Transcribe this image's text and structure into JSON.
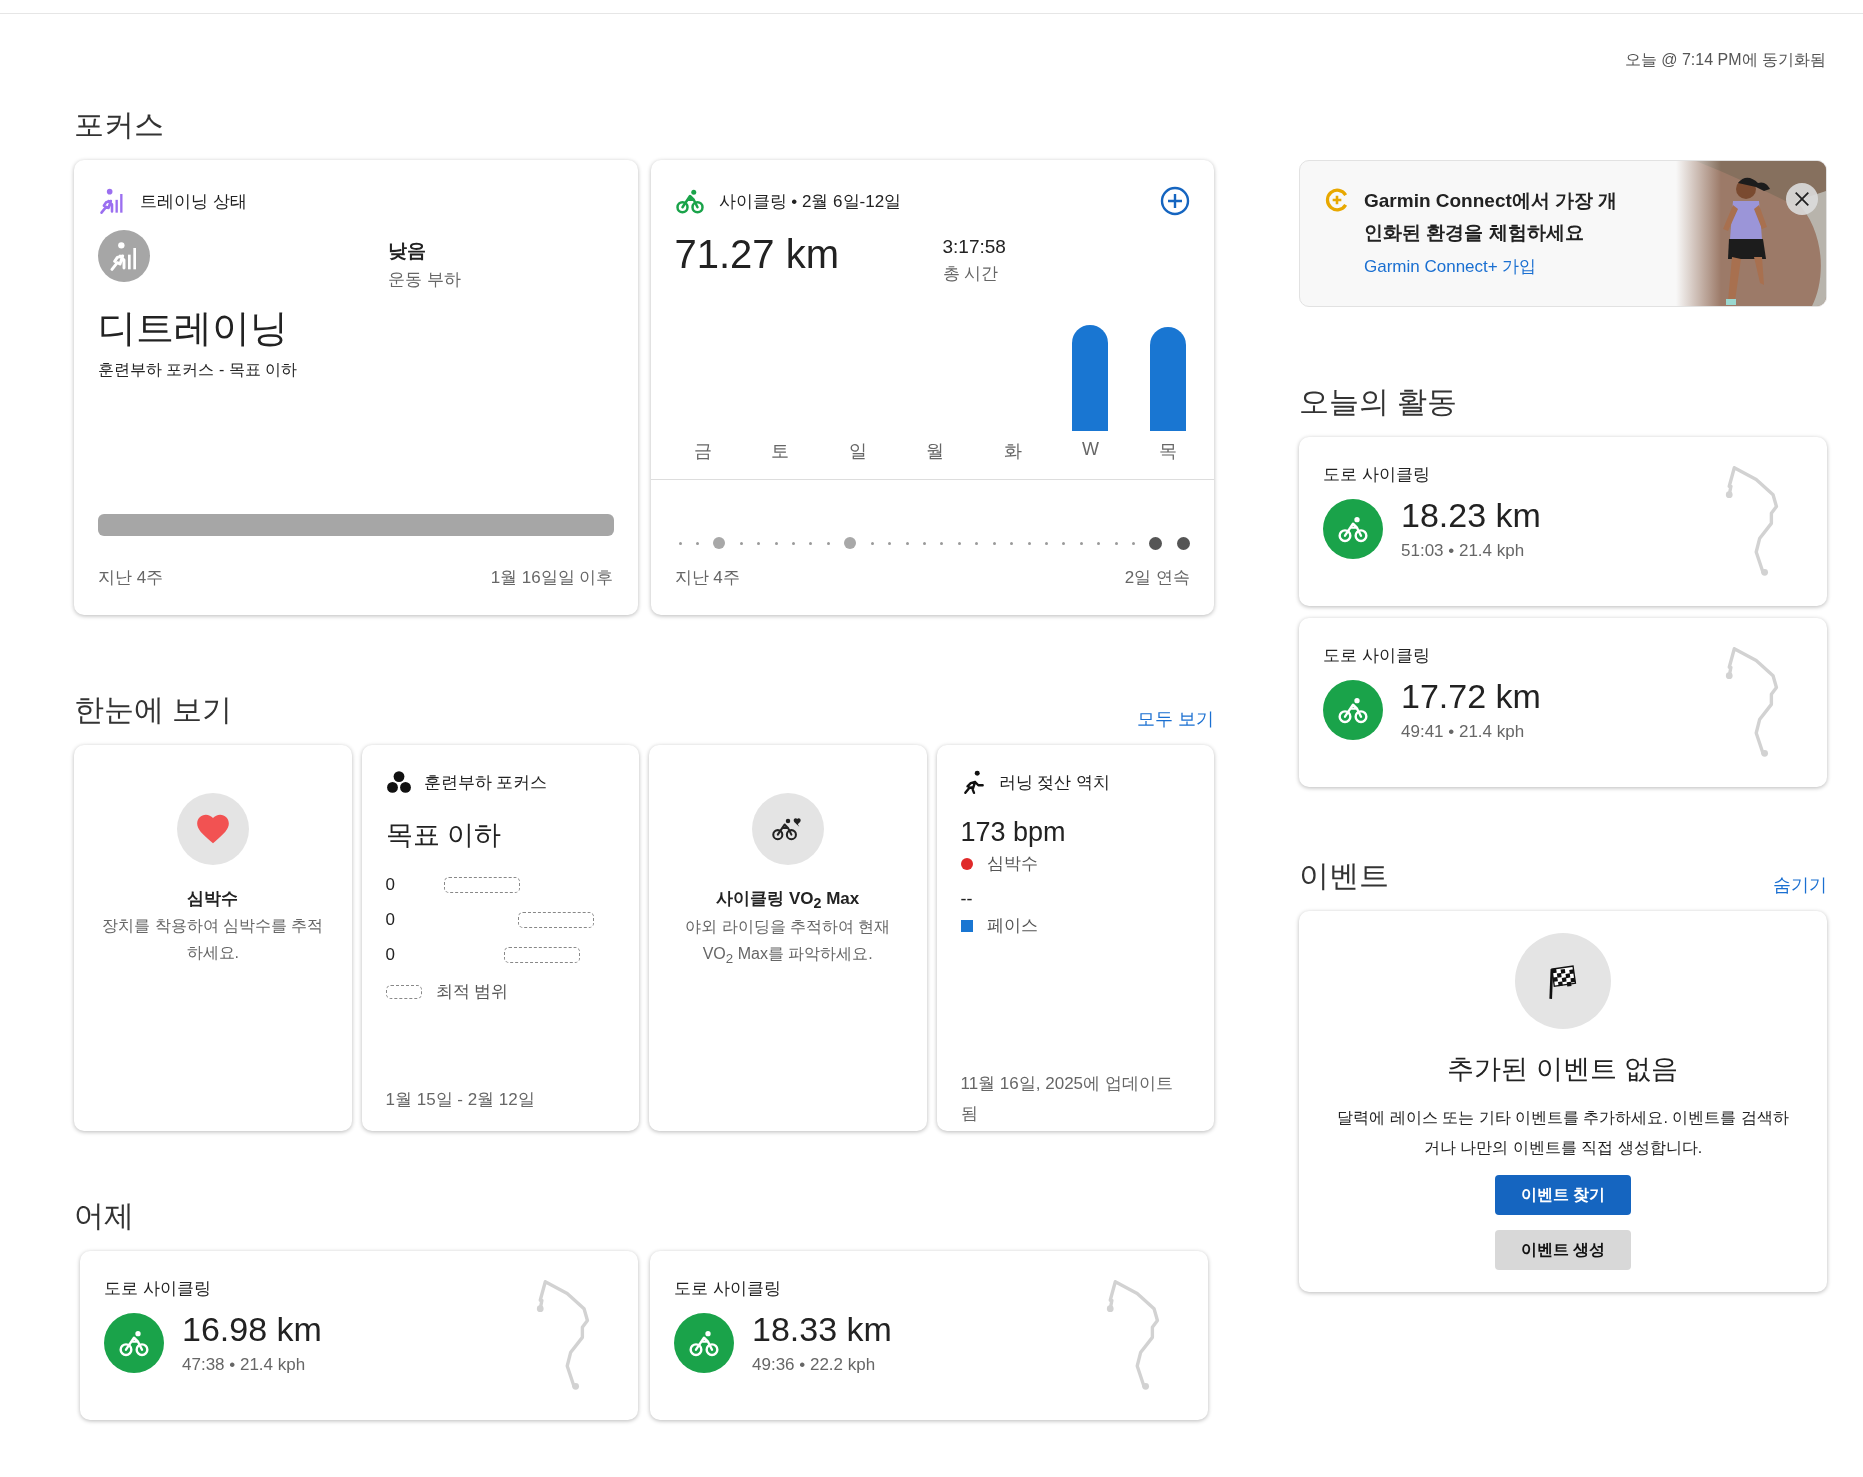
{
  "sync_status": "오늘 @ 7:14 PM에 동기화됨",
  "focus": {
    "title": "포커스",
    "training_status": {
      "title": "트레이닝 상태",
      "load_value": "낮음",
      "load_label": "운동 부하",
      "status": "디트레이닝",
      "subtitle": "훈련부하 포커스 - 목표 이하",
      "range_start": "지난 4주",
      "range_end": "1월 16일일 이후"
    },
    "cycling": {
      "title": "사이클링 • 2월 6일-12일",
      "distance": "71.27 km",
      "time": "3:17:58",
      "time_label": "총 시간",
      "days": [
        {
          "label": "금",
          "active": false
        },
        {
          "label": "토",
          "active": false
        },
        {
          "label": "일",
          "active": false
        },
        {
          "label": "월",
          "active": false
        },
        {
          "label": "화",
          "active": false
        },
        {
          "label": "W",
          "active": true
        },
        {
          "label": "목",
          "active": true
        }
      ],
      "streak": [
        {
          "kind": "rest"
        },
        {
          "kind": "rest"
        },
        {
          "kind": "ride"
        },
        {
          "kind": "rest"
        },
        {
          "kind": "rest"
        },
        {
          "kind": "rest"
        },
        {
          "kind": "rest"
        },
        {
          "kind": "rest"
        },
        {
          "kind": "rest"
        },
        {
          "kind": "ride"
        },
        {
          "kind": "rest"
        },
        {
          "kind": "rest"
        },
        {
          "kind": "rest"
        },
        {
          "kind": "rest"
        },
        {
          "kind": "rest"
        },
        {
          "kind": "rest"
        },
        {
          "kind": "rest"
        },
        {
          "kind": "rest"
        },
        {
          "kind": "rest"
        },
        {
          "kind": "rest"
        },
        {
          "kind": "rest"
        },
        {
          "kind": "rest"
        },
        {
          "kind": "rest"
        },
        {
          "kind": "rest"
        },
        {
          "kind": "rest"
        },
        {
          "kind": "rest"
        },
        {
          "kind": "streak"
        },
        {
          "kind": "streak"
        }
      ],
      "range_start": "지난 4주",
      "streak_label": "2일 연속"
    }
  },
  "glance": {
    "title": "한눈에 보기",
    "link": "모두 보기",
    "cards": [
      {
        "kind": "heart_rate",
        "title": "심박수",
        "text": "장치를 착용하여 심박수를 추적하세요."
      },
      {
        "kind": "load_focus",
        "title": "훈련부하 포커스",
        "value": "목표 이하",
        "rows": [
          "0",
          "0",
          "0"
        ],
        "legend": "최적 범위",
        "dates": "1월 15일 - 2월 12일"
      },
      {
        "kind": "vo2",
        "title": "사이클링 VO$_{2}$ Max",
        "text": "야외 라이딩을 추적하여 현재 VO$_{2}$ Max를 파악하세요."
      },
      {
        "kind": "lactate",
        "title": "러닝 젖산 역치",
        "value": "173 bpm",
        "value_label": "심박수",
        "pace": "--",
        "pace_label": "페이스",
        "updated": "11월 16일, 2025에 업데이트 됨"
      }
    ]
  },
  "yesterday": {
    "title": "어제",
    "activities": [
      {
        "type": "도로 사이클링",
        "distance": "16.98 km",
        "summary": "47:38 • 21.4 kph"
      },
      {
        "type": "도로 사이클링",
        "distance": "18.33 km",
        "summary": "49:36 • 22.2 kph"
      }
    ]
  },
  "promo": {
    "title": "Garmin Connect에서 가장 개인화된 환경을 체험하세요",
    "link": "Garmin Connect+ 가입"
  },
  "today": {
    "title": "오늘의 활동",
    "activities": [
      {
        "type": "도로 사이클링",
        "distance": "18.23 km",
        "summary": "51:03 • 21.4 kph"
      },
      {
        "type": "도로 사이클링",
        "distance": "17.72 km",
        "summary": "49:41 • 21.4 kph"
      }
    ]
  },
  "events": {
    "title": "이벤트",
    "link": "숨기기",
    "empty_title": "추가된 이벤트 없음",
    "text": "달력에 레이스 또는 기타 이벤트를 추가하세요. 이벤트를 검색하거나 나만의 이벤트를 직접 생성합니다.",
    "buttons": [
      {
        "label": "이벤트 찾기",
        "kind": "primary"
      },
      {
        "label": "이벤트 생성",
        "kind": "secondary"
      }
    ]
  }
}
